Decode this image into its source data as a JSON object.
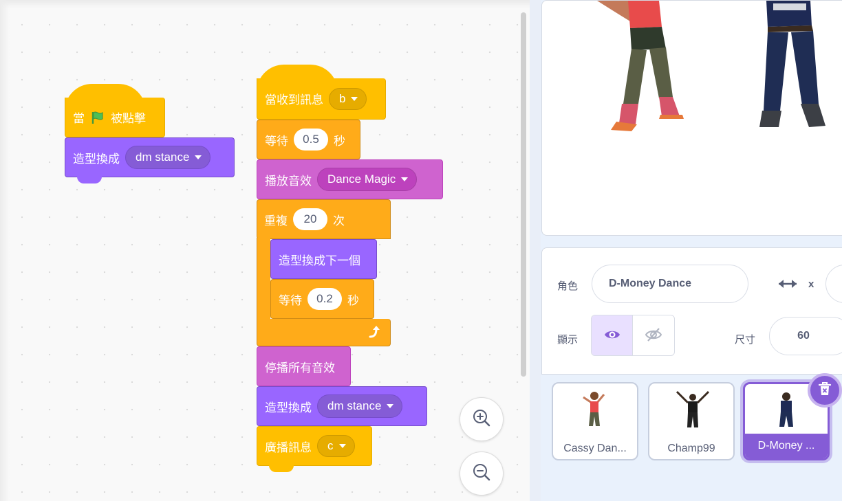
{
  "code": {
    "script1": {
      "hat_when": "當",
      "hat_clicked": "被點擊",
      "switch_costume": "造型換成",
      "costume_value": "dm stance"
    },
    "script2": {
      "hat_receive": "當收到訊息",
      "receive_value": "b",
      "wait1_label": "等待",
      "wait1_value": "0.5",
      "wait1_unit": "秒",
      "play_sound": "播放音效",
      "sound_value": "Dance Magic",
      "repeat_label": "重複",
      "repeat_value": "20",
      "repeat_unit": "次",
      "next_costume": "造型換成下一個",
      "wait2_label": "等待",
      "wait2_value": "0.2",
      "wait2_unit": "秒",
      "stop_sounds": "停播所有音效",
      "switch_costume2": "造型換成",
      "costume_value2": "dm stance",
      "broadcast": "廣播訊息",
      "broadcast_value": "c"
    }
  },
  "sprite_info": {
    "sprite_label": "角色",
    "sprite_name": "D-Money Dance",
    "x_label": "x",
    "show_label": "顯示",
    "size_label": "尺寸",
    "size_value": "60"
  },
  "sprites": [
    {
      "name": "Cassy Dan..."
    },
    {
      "name": "Champ99"
    },
    {
      "name": "D-Money ..."
    }
  ],
  "icons": {
    "flag": "green-flag-icon",
    "zoom_in": "zoom-in-icon",
    "zoom_out": "zoom-out-icon",
    "show": "eye-icon",
    "hide": "eye-off-icon",
    "delete": "trash-icon",
    "loop_arrow": "loop-arrow-icon"
  },
  "colors": {
    "events": "#ffbf00",
    "looks": "#9966ff",
    "sound": "#cf63cf",
    "control": "#ffab19",
    "accent": "#855cd6"
  }
}
